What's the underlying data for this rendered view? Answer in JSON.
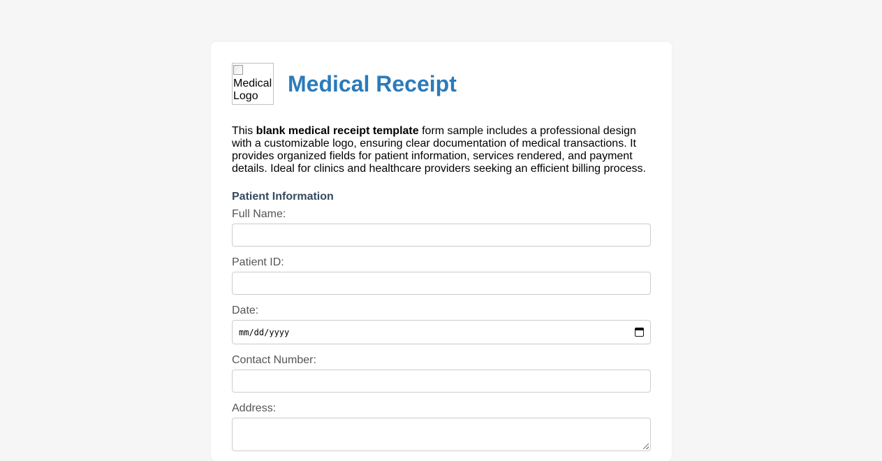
{
  "header": {
    "logo_alt": "Medical Logo",
    "title": "Medical Receipt"
  },
  "intro": {
    "prefix": "This ",
    "bold": "blank medical receipt template",
    "suffix": " form sample includes a professional design with a customizable logo, ensuring clear documentation of medical transactions. It provides organized fields for patient information, services rendered, and payment details. Ideal for clinics and healthcare providers seeking an efficient billing process."
  },
  "patient_section": {
    "title": "Patient Information",
    "full_name_label": "Full Name:",
    "full_name_value": "",
    "patient_id_label": "Patient ID:",
    "patient_id_value": "",
    "date_label": "Date:",
    "date_placeholder": "mm/dd/yyyy",
    "contact_label": "Contact Number:",
    "contact_value": "",
    "address_label": "Address:",
    "address_value": ""
  },
  "colors": {
    "title": "#2b7bbb",
    "section_title": "#34495e",
    "label": "#555555",
    "page_bg": "#f6f6f6"
  },
  "icons": {
    "date": "calendar-icon"
  }
}
